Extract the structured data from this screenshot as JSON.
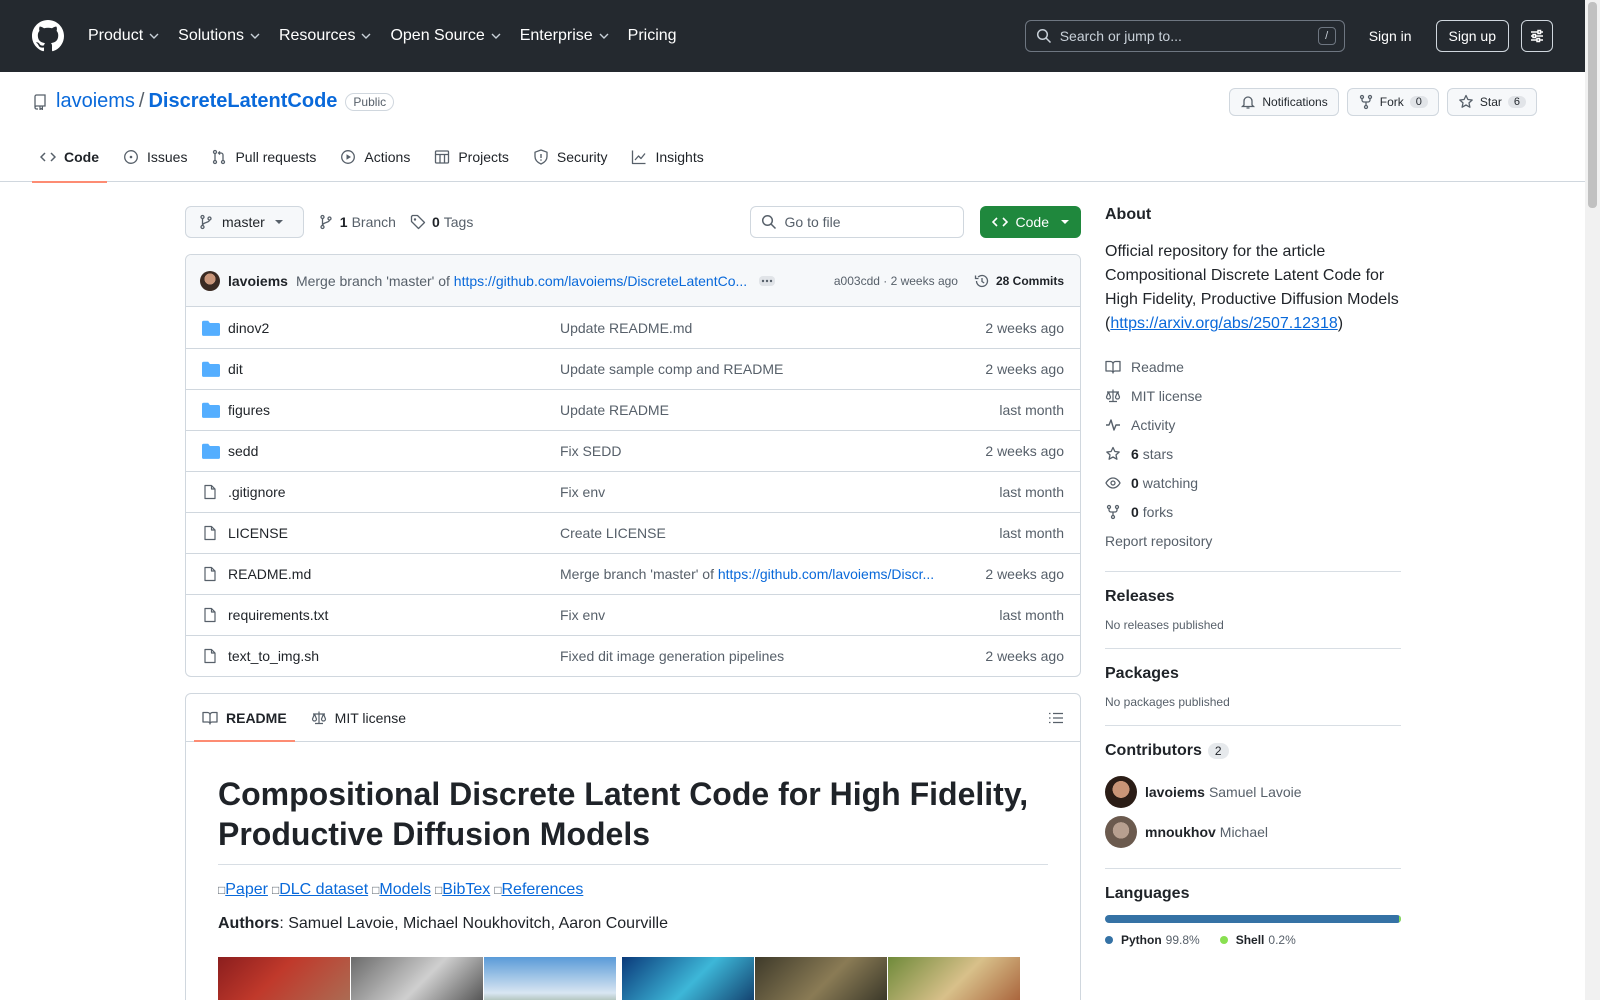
{
  "header": {
    "nav": [
      "Product",
      "Solutions",
      "Resources",
      "Open Source",
      "Enterprise",
      "Pricing"
    ],
    "nav_has_chevron": [
      true,
      true,
      true,
      true,
      true,
      false
    ],
    "search_placeholder": "Search or jump to...",
    "search_key": "/",
    "sign_in": "Sign in",
    "sign_up": "Sign up"
  },
  "repo": {
    "owner": "lavoiems",
    "sep": "/",
    "name": "DiscreteLatentCode",
    "visibility": "Public",
    "notifications": "Notifications",
    "fork_label": "Fork",
    "fork_count": "0",
    "star_label": "Star",
    "star_count": "6"
  },
  "tabs": [
    "Code",
    "Issues",
    "Pull requests",
    "Actions",
    "Projects",
    "Security",
    "Insights"
  ],
  "toolbar": {
    "branch": "master",
    "branch_count": "1",
    "branch_label": "Branch",
    "tag_count": "0",
    "tag_label": "Tags",
    "goto_file": "Go to file",
    "code": "Code"
  },
  "commit": {
    "author": "lavoiems",
    "message_prefix": "Merge branch 'master' of ",
    "message_link": "https://github.com/lavoiems/DiscreteLatentCo...",
    "sha_time": "a003cdd · 2 weeks ago",
    "commits": "28 Commits"
  },
  "files": [
    {
      "type": "dir",
      "name": "dinov2",
      "msg": "Update README.md",
      "link": "",
      "date": "2 weeks ago"
    },
    {
      "type": "dir",
      "name": "dit",
      "msg": "Update sample comp and README",
      "link": "",
      "date": "2 weeks ago"
    },
    {
      "type": "dir",
      "name": "figures",
      "msg": "Update README",
      "link": "",
      "date": "last month"
    },
    {
      "type": "dir",
      "name": "sedd",
      "msg": "Fix SEDD",
      "link": "",
      "date": "2 weeks ago"
    },
    {
      "type": "file",
      "name": ".gitignore",
      "msg": "Fix env",
      "link": "",
      "date": "last month"
    },
    {
      "type": "file",
      "name": "LICENSE",
      "msg": "Create LICENSE",
      "link": "",
      "date": "last month"
    },
    {
      "type": "file",
      "name": "README.md",
      "msg": "Merge branch 'master' of ",
      "link": "https://github.com/lavoiems/Discr...",
      "date": "2 weeks ago"
    },
    {
      "type": "file",
      "name": "requirements.txt",
      "msg": "Fix env",
      "link": "",
      "date": "last month"
    },
    {
      "type": "file",
      "name": "text_to_img.sh",
      "msg": "Fixed dit image generation pipelines",
      "link": "",
      "date": "2 weeks ago"
    }
  ],
  "readme": {
    "tab_readme": "README",
    "tab_license": "MIT license",
    "title": "Compositional Discrete Latent Code for High Fidelity, Productive Diffusion Models",
    "links": [
      "Paper",
      "DLC dataset",
      "Models",
      "BibTex",
      "References"
    ],
    "link_marker": "□",
    "authors_label": "Authors",
    "authors": ": Samuel Lavoie, Michael Noukhovitch, Aaron Courville"
  },
  "about": {
    "heading": "About",
    "text": "Official repository for the article Compositional Discrete Latent Code for High Fidelity, Productive Diffusion Models (",
    "link": "https://arxiv.org/abs/2507.12318",
    "text_end": ")",
    "readme": "Readme",
    "license": "MIT license",
    "activity": "Activity",
    "stars_count": "6",
    "stars_label": "stars",
    "watching_count": "0",
    "watching_label": "watching",
    "forks_count": "0",
    "forks_label": "forks",
    "report": "Report repository"
  },
  "releases": {
    "heading": "Releases",
    "text": "No releases published"
  },
  "packages": {
    "heading": "Packages",
    "text": "No packages published"
  },
  "contributors": {
    "heading": "Contributors",
    "count": "2",
    "list": [
      {
        "login": "lavoiems",
        "name": "Samuel Lavoie"
      },
      {
        "login": "mnoukhov",
        "name": "Michael"
      }
    ]
  },
  "languages": {
    "heading": "Languages",
    "list": [
      {
        "name": "Python",
        "pct": "99.8%",
        "color": "#3572A5"
      },
      {
        "name": "Shell",
        "pct": "0.2%",
        "color": "#89e051"
      }
    ]
  }
}
